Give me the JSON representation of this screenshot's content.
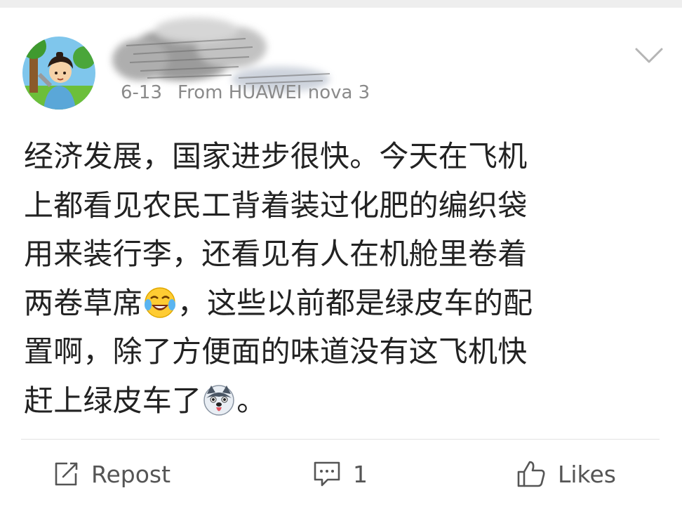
{
  "post": {
    "timestamp": "6-13",
    "source": "From HUAWEI nova 3",
    "lines": [
      {
        "text_a": "经济发展，国家进步很快。今天在飞机",
        "emoji": "",
        "text_b": ""
      },
      {
        "text_a": "上都看见农民工背着装过化肥的编织袋",
        "emoji": "",
        "text_b": ""
      },
      {
        "text_a": "用来装行李，还看见有人在机舱里卷着",
        "emoji": "",
        "text_b": ""
      },
      {
        "text_a": "两卷草席",
        "emoji": "laughing-crying-emoji",
        "text_b": "，这些以前都是绿皮车的配"
      },
      {
        "text_a": "置啊，除了方便面的味道没有这飞机快",
        "emoji": "",
        "text_b": ""
      },
      {
        "text_a": "赶上绿皮车了",
        "emoji": "husky-dog-emoji",
        "text_b": "。"
      }
    ]
  },
  "actions": {
    "repost_label": "Repost",
    "comment_count": "1",
    "like_label": "Likes"
  },
  "icons": {
    "avatar": "cartoon-avatar",
    "menu": "chevron-down-icon",
    "repost": "repost-icon",
    "comment": "comment-icon",
    "like": "thumbs-up-icon"
  },
  "colors": {
    "text": "#222222",
    "meta": "#8a8a8a",
    "action": "#555555",
    "divider": "#e3e3e3"
  }
}
